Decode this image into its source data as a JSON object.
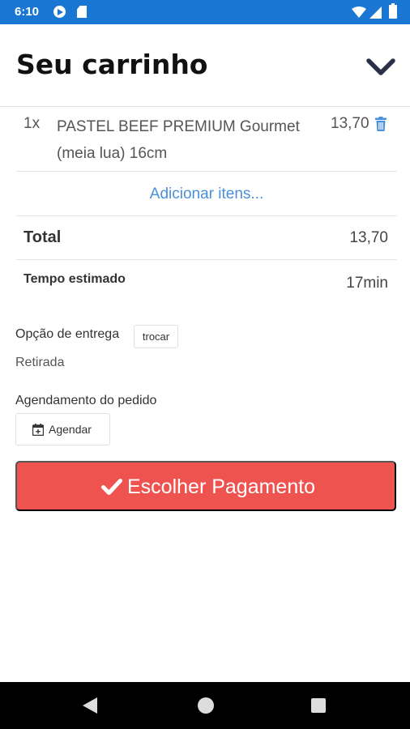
{
  "status_bar": {
    "time": "6:10"
  },
  "header": {
    "title": "Seu carrinho"
  },
  "cart": {
    "items": [
      {
        "qty": "1x",
        "name": "PASTEL BEEF PREMIUM Gourmet (meia lua) 16cm",
        "price": "13,70"
      }
    ],
    "add_items_link": "Adicionar itens..."
  },
  "summary": {
    "total_label": "Total",
    "total_value": "13,70",
    "eta_label": "Tempo estimado",
    "eta_value": "17min"
  },
  "delivery": {
    "label": "Opção de entrega",
    "swap_button": "trocar",
    "value": "Retirada"
  },
  "schedule": {
    "label": "Agendamento do pedido",
    "button": "Agendar"
  },
  "payment": {
    "button": "Escolher Pagamento"
  },
  "colors": {
    "status_bar": "#1976d2",
    "accent_link": "#4a90d9",
    "pay_button": "#ef5350"
  },
  "icons": [
    "play-protect-icon",
    "sd-card-icon",
    "wifi-icon",
    "signal-icon",
    "battery-icon",
    "chevron-down-icon",
    "trash-icon",
    "calendar-plus-icon",
    "check-icon",
    "back-icon",
    "home-icon",
    "recents-icon"
  ]
}
